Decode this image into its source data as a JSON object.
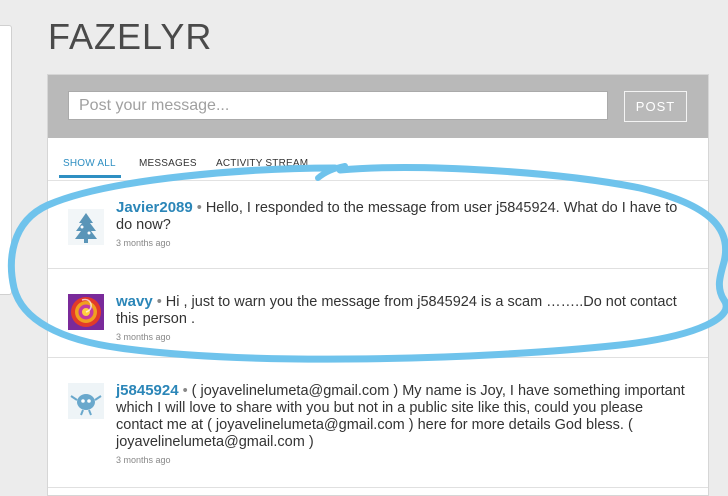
{
  "app": {
    "title": "FAZELYR"
  },
  "compose": {
    "placeholder": "Post your message...",
    "post_label": "POST"
  },
  "tabs": [
    {
      "label": "SHOW ALL",
      "active": true
    },
    {
      "label": "MESSAGES",
      "active": false
    },
    {
      "label": "ACTIVITY STREAM",
      "active": false
    }
  ],
  "posts": [
    {
      "username": "Javier2089",
      "avatar_icon": "tree-icon",
      "text": "Hello, I responded to the message from user j5845924. What do I have to do now?",
      "time": "3 months ago"
    },
    {
      "username": "wavy",
      "avatar_icon": "swirl-icon",
      "text": "Hi , just to warn you the message from j5845924 is a scam ……..Do not contact this person .",
      "time": "3 months ago"
    },
    {
      "username": "j5845924",
      "avatar_icon": "creature-icon",
      "text": "( joyavelinelumeta@gmail.com ) My name is Joy, I have something important which I will love to share with you but not in a public site like this, could you please contact me at ( joyavelinelumeta@gmail.com ) here for more details God bless. ( joyavelinelumeta@gmail.com )",
      "time": "3 months ago"
    }
  ],
  "colors": {
    "accent": "#2f8fc2",
    "username": "#2b86b8",
    "scribble": "#6fc3ec",
    "compose_bar": "#b9b9b9"
  }
}
